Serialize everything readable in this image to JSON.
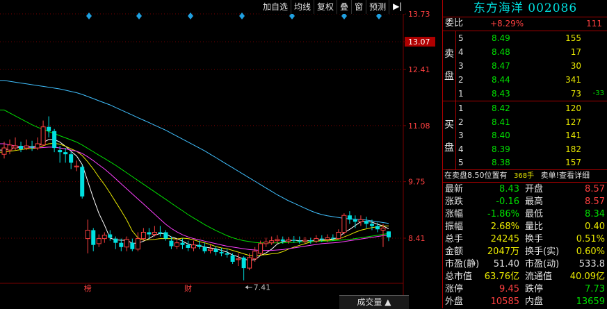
{
  "toolbar": {
    "buttons": [
      "加自选",
      "均线",
      "复权",
      "叠",
      "窗",
      "预测"
    ],
    "arrow": "▶|"
  },
  "stock": {
    "title": "东方海洋 002086"
  },
  "weibi": {
    "label": "委比",
    "value": "+8.29%",
    "diff": "111"
  },
  "sell_label": [
    "卖",
    "盘"
  ],
  "buy_label": [
    "买",
    "盘"
  ],
  "sell_orders": [
    {
      "level": "5",
      "price": "8.49",
      "volume": "155",
      "change": ""
    },
    {
      "level": "4",
      "price": "8.48",
      "volume": "17",
      "change": ""
    },
    {
      "level": "3",
      "price": "8.47",
      "volume": "30",
      "change": ""
    },
    {
      "level": "2",
      "price": "8.44",
      "volume": "341",
      "change": ""
    },
    {
      "level": "1",
      "price": "8.43",
      "volume": "73",
      "change": "-33"
    }
  ],
  "buy_orders": [
    {
      "level": "1",
      "price": "8.42",
      "volume": "120"
    },
    {
      "level": "2",
      "price": "8.41",
      "volume": "127"
    },
    {
      "level": "3",
      "price": "8.40",
      "volume": "141"
    },
    {
      "level": "4",
      "price": "8.39",
      "volume": "182"
    },
    {
      "level": "5",
      "price": "8.38",
      "volume": "157"
    }
  ],
  "info_bar": {
    "left": "在卖盘8.50位置有",
    "volume": "368手",
    "right": "卖单!查看详细"
  },
  "stats": [
    {
      "l1": "最新",
      "v1": "8.43",
      "c1": "green",
      "l2": "开盘",
      "v2": "8.57",
      "c2": "red"
    },
    {
      "l1": "涨跌",
      "v1": "-0.16",
      "c1": "green",
      "l2": "最高",
      "v2": "8.57",
      "c2": "red"
    },
    {
      "l1": "涨幅",
      "v1": "-1.86%",
      "c1": "green",
      "l2": "最低",
      "v2": "8.34",
      "c2": "green"
    },
    {
      "l1": "振幅",
      "v1": "2.68%",
      "c1": "yel",
      "l2": "量比",
      "v2": "0.40",
      "c2": "yel"
    },
    {
      "l1": "总手",
      "v1": "24245",
      "c1": "yel",
      "l2": "换手",
      "v2": "0.51%",
      "c2": "yel"
    },
    {
      "l1": "金额",
      "v1": "2047万",
      "c1": "yel",
      "l2": "换手(实)",
      "v2": "0.60%",
      "c2": "yel"
    },
    {
      "l1": "市盈(静)",
      "v1": "51.40",
      "c1": "white",
      "l2": "市盈(动)",
      "v2": "533.8",
      "c2": "white"
    },
    {
      "l1": "总市值",
      "v1": "63.76亿",
      "c1": "yel",
      "l2": "流通值",
      "v2": "40.09亿",
      "c2": "yel"
    },
    {
      "l1": "涨停",
      "v1": "9.45",
      "c1": "red",
      "l2": "跌停",
      "v2": "7.73",
      "c2": "green"
    },
    {
      "l1": "外盘",
      "v1": "10585",
      "c1": "red",
      "l2": "内盘",
      "v2": "13659",
      "c2": "green"
    }
  ],
  "bottom_button": "成交量",
  "colors": {
    "up": "#ff4040",
    "down": "#00e0e0",
    "ma5": "#ffffff",
    "ma10": "#e8e800",
    "ma20": "#ff40ff",
    "ma30": "#00e000",
    "ma60": "#40c0ff",
    "grid": "#7a0000"
  },
  "chart_data": {
    "type": "candlestick",
    "y_ticks": [
      "13.73",
      "13.07",
      "12.41",
      "11.08",
      "9.75",
      "8.41"
    ],
    "y_tick_values": [
      13.73,
      13.07,
      12.41,
      11.08,
      9.75,
      8.41
    ],
    "ylim": [
      7.0,
      13.73
    ],
    "current_price_label": "13.07",
    "low_marker": {
      "label": "7.41",
      "value": 7.41,
      "index": 43
    },
    "event_markers": [
      {
        "label": "榜",
        "index": 15
      },
      {
        "label": "财",
        "index": 33
      }
    ],
    "candles": [
      {
        "o": 10.4,
        "c": 10.55,
        "h": 10.7,
        "l": 10.3
      },
      {
        "o": 10.5,
        "c": 10.62,
        "h": 10.75,
        "l": 10.4
      },
      {
        "o": 10.55,
        "c": 10.6,
        "h": 10.8,
        "l": 10.5
      },
      {
        "o": 10.6,
        "c": 10.52,
        "h": 10.7,
        "l": 10.45
      },
      {
        "o": 10.55,
        "c": 10.6,
        "h": 10.75,
        "l": 10.5
      },
      {
        "o": 10.58,
        "c": 10.56,
        "h": 10.72,
        "l": 10.48
      },
      {
        "o": 10.55,
        "c": 10.65,
        "h": 10.8,
        "l": 10.5
      },
      {
        "o": 10.62,
        "c": 11.05,
        "h": 11.2,
        "l": 10.6
      },
      {
        "o": 11.05,
        "c": 10.95,
        "h": 11.3,
        "l": 10.8
      },
      {
        "o": 10.95,
        "c": 10.55,
        "h": 11.0,
        "l": 10.45
      },
      {
        "o": 10.5,
        "c": 10.45,
        "h": 10.6,
        "l": 10.2
      },
      {
        "o": 10.45,
        "c": 10.4,
        "h": 10.55,
        "l": 10.2
      },
      {
        "o": 10.4,
        "c": 10.2,
        "h": 10.45,
        "l": 10.05
      },
      {
        "o": 10.1,
        "c": 10.12,
        "h": 10.25,
        "l": 10.0
      },
      {
        "o": 10.1,
        "c": 9.4,
        "h": 10.15,
        "l": 9.35
      },
      {
        "o": 8.4,
        "c": 8.6,
        "h": 8.85,
        "l": 8.05
      },
      {
        "o": 8.6,
        "c": 8.25,
        "h": 8.65,
        "l": 8.1
      },
      {
        "o": 8.28,
        "c": 8.4,
        "h": 8.5,
        "l": 8.2
      },
      {
        "o": 8.4,
        "c": 8.48,
        "h": 8.55,
        "l": 8.3
      },
      {
        "o": 8.5,
        "c": 8.42,
        "h": 8.6,
        "l": 8.35
      },
      {
        "o": 8.4,
        "c": 8.3,
        "h": 8.45,
        "l": 8.15
      },
      {
        "o": 8.3,
        "c": 8.2,
        "h": 8.4,
        "l": 8.1
      },
      {
        "o": 8.2,
        "c": 8.38,
        "h": 8.45,
        "l": 8.1
      },
      {
        "o": 8.3,
        "c": 8.15,
        "h": 8.4,
        "l": 8.1
      },
      {
        "o": 8.15,
        "c": 8.4,
        "h": 8.55,
        "l": 8.1
      },
      {
        "o": 8.4,
        "c": 8.55,
        "h": 8.65,
        "l": 8.35
      },
      {
        "o": 8.55,
        "c": 8.5,
        "h": 8.65,
        "l": 8.4
      },
      {
        "o": 8.5,
        "c": 8.55,
        "h": 8.7,
        "l": 8.45
      },
      {
        "o": 8.55,
        "c": 8.52,
        "h": 8.7,
        "l": 8.45
      },
      {
        "o": 8.55,
        "c": 8.4,
        "h": 8.6,
        "l": 8.35
      },
      {
        "o": 8.35,
        "c": 8.22,
        "h": 8.45,
        "l": 8.15
      },
      {
        "o": 8.22,
        "c": 8.3,
        "h": 8.4,
        "l": 8.15
      },
      {
        "o": 8.3,
        "c": 8.25,
        "h": 8.4,
        "l": 8.15
      },
      {
        "o": 8.25,
        "c": 8.18,
        "h": 8.35,
        "l": 8.1
      },
      {
        "o": 8.18,
        "c": 8.25,
        "h": 8.35,
        "l": 8.1
      },
      {
        "o": 8.25,
        "c": 8.2,
        "h": 8.35,
        "l": 8.15
      },
      {
        "o": 8.2,
        "c": 8.1,
        "h": 8.3,
        "l": 8.05
      },
      {
        "o": 8.12,
        "c": 8.15,
        "h": 8.25,
        "l": 8.05
      },
      {
        "o": 8.15,
        "c": 8.08,
        "h": 8.22,
        "l": 8.0
      },
      {
        "o": 8.08,
        "c": 8.05,
        "h": 8.18,
        "l": 7.98
      },
      {
        "o": 8.05,
        "c": 8.02,
        "h": 8.15,
        "l": 7.95
      },
      {
        "o": 8.0,
        "c": 7.85,
        "h": 8.05,
        "l": 7.8
      },
      {
        "o": 7.9,
        "c": 7.92,
        "h": 8.05,
        "l": 7.75
      },
      {
        "o": 7.95,
        "c": 7.7,
        "h": 7.98,
        "l": 7.41
      },
      {
        "o": 7.7,
        "c": 7.95,
        "h": 8.05,
        "l": 7.65
      },
      {
        "o": 7.92,
        "c": 8.1,
        "h": 8.2,
        "l": 7.85
      },
      {
        "o": 8.05,
        "c": 8.28,
        "h": 8.35,
        "l": 8.0
      },
      {
        "o": 8.28,
        "c": 8.32,
        "h": 8.42,
        "l": 8.2
      },
      {
        "o": 8.3,
        "c": 8.35,
        "h": 8.45,
        "l": 8.25
      },
      {
        "o": 8.35,
        "c": 8.38,
        "h": 8.48,
        "l": 8.28
      },
      {
        "o": 8.38,
        "c": 8.34,
        "h": 8.45,
        "l": 8.28
      },
      {
        "o": 8.34,
        "c": 8.37,
        "h": 8.44,
        "l": 8.28
      },
      {
        "o": 8.37,
        "c": 8.35,
        "h": 8.46,
        "l": 8.3
      },
      {
        "o": 8.35,
        "c": 8.33,
        "h": 8.45,
        "l": 8.28
      },
      {
        "o": 8.33,
        "c": 8.36,
        "h": 8.44,
        "l": 8.28
      },
      {
        "o": 8.36,
        "c": 8.34,
        "h": 8.42,
        "l": 8.28
      },
      {
        "o": 8.34,
        "c": 8.4,
        "h": 8.48,
        "l": 8.3
      },
      {
        "o": 8.4,
        "c": 8.38,
        "h": 8.48,
        "l": 8.32
      },
      {
        "o": 8.38,
        "c": 8.42,
        "h": 8.5,
        "l": 8.32
      },
      {
        "o": 8.42,
        "c": 8.4,
        "h": 8.5,
        "l": 8.35
      },
      {
        "o": 8.4,
        "c": 8.55,
        "h": 8.62,
        "l": 8.38
      },
      {
        "o": 8.55,
        "c": 8.95,
        "h": 9.0,
        "l": 8.5
      },
      {
        "o": 8.95,
        "c": 8.85,
        "h": 9.05,
        "l": 8.75
      },
      {
        "o": 8.85,
        "c": 8.8,
        "h": 8.95,
        "l": 8.65
      },
      {
        "o": 8.8,
        "c": 8.85,
        "h": 8.95,
        "l": 8.7
      },
      {
        "o": 8.82,
        "c": 8.75,
        "h": 8.92,
        "l": 8.65
      },
      {
        "o": 8.75,
        "c": 8.7,
        "h": 8.85,
        "l": 8.6
      },
      {
        "o": 8.7,
        "c": 8.62,
        "h": 8.78,
        "l": 8.55
      },
      {
        "o": 8.6,
        "c": 8.65,
        "h": 8.75,
        "l": 8.2
      },
      {
        "o": 8.57,
        "c": 8.43,
        "h": 8.57,
        "l": 8.34
      }
    ],
    "ma_lines": [
      {
        "name": "MA5",
        "values": [
          10.5,
          10.53,
          10.56,
          10.57,
          10.58,
          10.58,
          10.59,
          10.68,
          10.75,
          10.75,
          10.69,
          10.59,
          10.47,
          10.36,
          10.16,
          9.76,
          9.36,
          9.0,
          8.72,
          8.41,
          8.37,
          8.36,
          8.36,
          8.29,
          8.29,
          8.34,
          8.4,
          8.48,
          8.52,
          8.51,
          8.44,
          8.4,
          8.34,
          8.27,
          8.24,
          8.24,
          8.2,
          8.18,
          8.16,
          8.12,
          8.08,
          8.01,
          7.97,
          7.91,
          7.89,
          7.9,
          8.0,
          8.06,
          8.15,
          8.27,
          8.33,
          8.35,
          8.36,
          8.35,
          8.35,
          8.35,
          8.36,
          8.37,
          8.38,
          8.39,
          8.43,
          8.54,
          8.62,
          8.71,
          8.8,
          8.8,
          8.79,
          8.74,
          8.7,
          8.63
        ]
      },
      {
        "name": "MA10",
        "values": [
          10.45,
          10.47,
          10.49,
          10.51,
          10.53,
          10.54,
          10.55,
          10.6,
          10.65,
          10.66,
          10.64,
          10.59,
          10.53,
          10.47,
          10.37,
          10.22,
          10.05,
          9.86,
          9.68,
          9.48,
          9.27,
          9.06,
          8.84,
          8.58,
          8.42,
          8.36,
          8.37,
          8.38,
          8.4,
          8.4,
          8.4,
          8.39,
          8.41,
          8.4,
          8.37,
          8.33,
          8.3,
          8.26,
          8.21,
          8.18,
          8.16,
          8.12,
          8.08,
          8.04,
          8.0,
          7.99,
          8.01,
          8.02,
          8.04,
          8.05,
          8.09,
          8.15,
          8.2,
          8.24,
          8.28,
          8.32,
          8.34,
          8.35,
          8.36,
          8.37,
          8.39,
          8.44,
          8.49,
          8.55,
          8.6,
          8.63,
          8.66,
          8.68,
          8.7,
          8.7
        ]
      },
      {
        "name": "MA20",
        "values": [
          10.65,
          10.62,
          10.6,
          10.58,
          10.57,
          10.56,
          10.55,
          10.56,
          10.57,
          10.57,
          10.55,
          10.53,
          10.5,
          10.47,
          10.42,
          10.34,
          10.25,
          10.15,
          10.05,
          9.94,
          9.82,
          9.7,
          9.58,
          9.46,
          9.34,
          9.22,
          9.1,
          8.98,
          8.86,
          8.74,
          8.64,
          8.56,
          8.49,
          8.44,
          8.4,
          8.37,
          8.34,
          8.31,
          8.28,
          8.25,
          8.22,
          8.2,
          8.18,
          8.16,
          8.14,
          8.13,
          8.12,
          8.12,
          8.12,
          8.13,
          8.14,
          8.16,
          8.18,
          8.2,
          8.22,
          8.24,
          8.26,
          8.28,
          8.29,
          8.3,
          8.31,
          8.33,
          8.35,
          8.37,
          8.39,
          8.41,
          8.43,
          8.45,
          8.47,
          8.48
        ]
      },
      {
        "name": "MA30",
        "values": [
          11.45,
          11.38,
          11.31,
          11.24,
          11.17,
          11.1,
          11.04,
          10.99,
          10.94,
          10.89,
          10.84,
          10.79,
          10.74,
          10.69,
          10.62,
          10.54,
          10.46,
          10.38,
          10.3,
          10.22,
          10.14,
          10.05,
          9.96,
          9.87,
          9.78,
          9.69,
          9.6,
          9.51,
          9.42,
          9.33,
          9.24,
          9.15,
          9.06,
          8.97,
          8.89,
          8.81,
          8.73,
          8.66,
          8.59,
          8.53,
          8.47,
          8.42,
          8.38,
          8.35,
          8.33,
          8.31,
          8.3,
          8.3,
          8.3,
          8.3,
          8.3,
          8.31,
          8.31,
          8.32,
          8.32,
          8.33,
          8.33,
          8.34,
          8.34,
          8.35,
          8.36,
          8.37,
          8.38,
          8.4,
          8.42,
          8.44,
          8.46,
          8.48,
          8.5,
          8.52
        ]
      },
      {
        "name": "MA60",
        "values": [
          12.15,
          12.13,
          12.11,
          12.09,
          12.07,
          12.05,
          12.03,
          12.01,
          11.99,
          11.97,
          11.95,
          11.92,
          11.89,
          11.86,
          11.82,
          11.77,
          11.72,
          11.67,
          11.62,
          11.57,
          11.51,
          11.45,
          11.39,
          11.33,
          11.27,
          11.21,
          11.15,
          11.09,
          11.03,
          10.97,
          10.9,
          10.83,
          10.76,
          10.69,
          10.62,
          10.55,
          10.48,
          10.4,
          10.32,
          10.24,
          10.16,
          10.08,
          10.0,
          9.92,
          9.84,
          9.76,
          9.68,
          9.6,
          9.52,
          9.44,
          9.37,
          9.3,
          9.24,
          9.18,
          9.12,
          9.06,
          9.01,
          8.97,
          8.94,
          8.92,
          8.9,
          8.88,
          8.87,
          8.86,
          8.85,
          8.84,
          8.82,
          8.8,
          8.78,
          8.76
        ]
      }
    ]
  }
}
